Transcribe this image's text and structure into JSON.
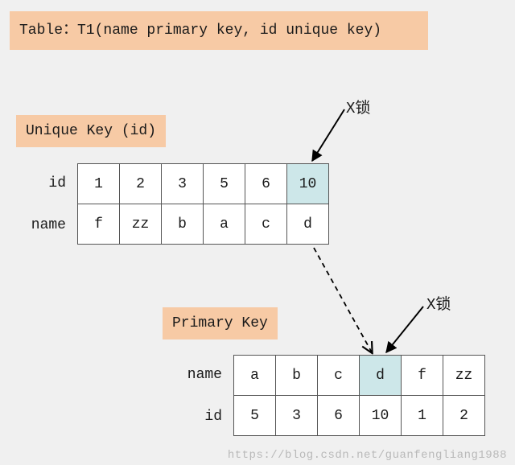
{
  "title": "Table：T1(name primary key, id unique key)",
  "unique_key": {
    "label": "Unique Key (id)",
    "row_labels": {
      "id": "id",
      "name": "name"
    },
    "id": [
      "1",
      "2",
      "3",
      "5",
      "6",
      "10"
    ],
    "name": [
      "f",
      "zz",
      "b",
      "a",
      "c",
      "d"
    ],
    "highlight_index": 5
  },
  "primary_key": {
    "label": "Primary Key",
    "row_labels": {
      "name": "name",
      "id": "id"
    },
    "name": [
      "a",
      "b",
      "c",
      "d",
      "f",
      "zz"
    ],
    "id": [
      "5",
      "3",
      "6",
      "10",
      "1",
      "2"
    ],
    "highlight_index": 3
  },
  "lock": {
    "label1": "X锁",
    "label2": "X锁"
  },
  "watermark": "https://blog.csdn.net/guanfengliang1988"
}
